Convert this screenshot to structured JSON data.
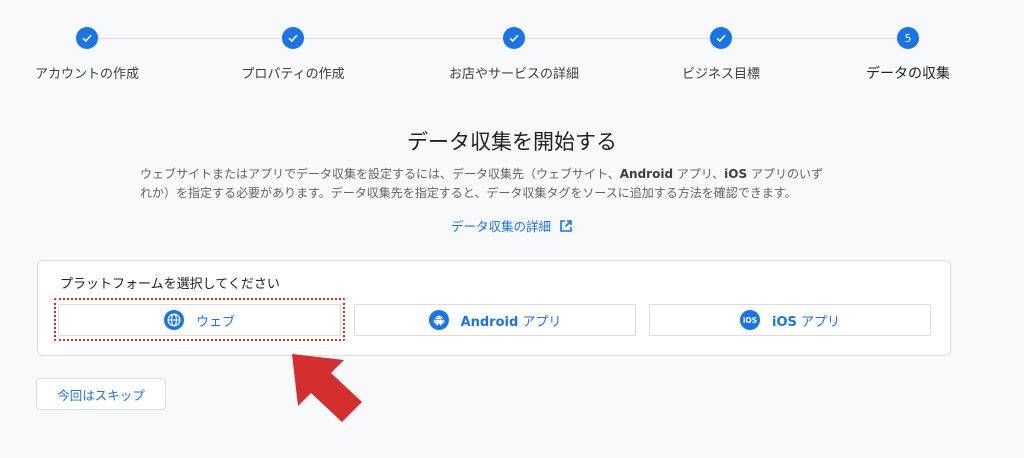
{
  "stepper": {
    "steps": [
      {
        "label": "アカウントの作成",
        "state": "done",
        "number": ""
      },
      {
        "label": "プロパティの作成",
        "state": "done",
        "number": ""
      },
      {
        "label": "お店やサービスの詳細",
        "state": "done",
        "number": ""
      },
      {
        "label": "ビジネス目標",
        "state": "done",
        "number": ""
      },
      {
        "label": "データの収集",
        "state": "active",
        "number": "5"
      }
    ]
  },
  "main": {
    "title": "データ収集を開始する",
    "description_line1_a": "ウェブサイトまたはアプリでデータ収集を設定するには、データ収集先（ウェブサイト、",
    "description_line1_b": "Android",
    "description_line1_c": " アプリ、",
    "description_line1_d": "iOS",
    "description_line1_e": " アプリのいず",
    "description_line2": "れか）を指定する必要があります。データ収集先を指定すると、データ収集タグをソースに追加する方法を確認できます。",
    "detail_link": "データ収集の詳細"
  },
  "platform": {
    "heading": "プラットフォームを選択してください",
    "options": [
      {
        "label": "ウェブ",
        "icon": "globe-icon"
      },
      {
        "label_bold": "Android",
        "label": " アプリ",
        "icon": "android-icon"
      },
      {
        "label_bold": "iOS",
        "label": " アプリ",
        "icon": "ios-icon"
      }
    ]
  },
  "skip_label": "今回はスキップ",
  "colors": {
    "accent": "#1a73e8",
    "highlight": "#d93025",
    "arrow": "#d32f2f",
    "background": "#f8f9fa"
  }
}
